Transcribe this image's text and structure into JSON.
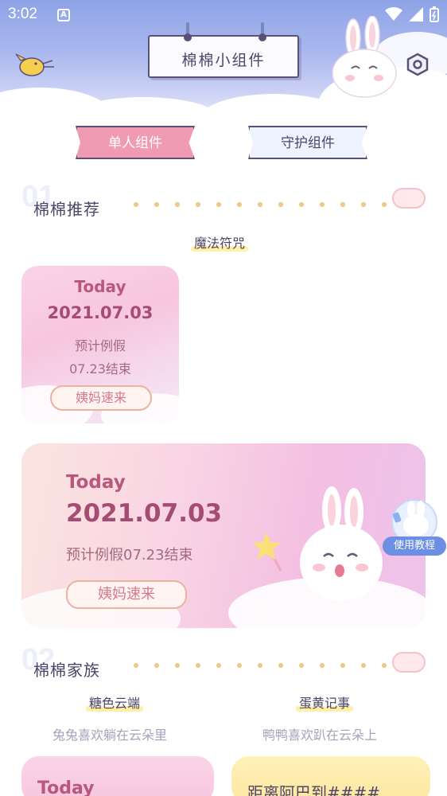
{
  "status_bar": {
    "time": "3:02",
    "keyboard_badge": "A"
  },
  "header": {
    "title": "棉棉小组件"
  },
  "tabs": [
    {
      "label": "单人组件",
      "active": true
    },
    {
      "label": "守护组件",
      "active": false
    }
  ],
  "section_recommend": {
    "number": "01",
    "title": "棉棉推荐",
    "subtitle": "魔法符咒",
    "small_card": {
      "today": "Today",
      "date": "2021.07.03",
      "line1": "预计例假",
      "line2": "07.23结束",
      "ribbon": "姨妈速来"
    },
    "big_card": {
      "today": "Today",
      "date": "2021.07.03",
      "line1": "预计例假07.23结束",
      "ribbon": "姨妈速来"
    }
  },
  "help_button": {
    "label": "使用教程"
  },
  "section_family": {
    "number": "02",
    "title": "棉棉家族",
    "items": [
      {
        "name": "糖色云端",
        "desc": "兔兔喜欢躺在云朵里",
        "card_title": "Today"
      },
      {
        "name": "蛋黄记事",
        "desc": "鸭鸭喜欢趴在云朵上",
        "card_title": "距离阿巴到####"
      }
    ]
  },
  "colors": {
    "accent_pink": "#f19ab4",
    "header_sky": "#8ea3e6",
    "help_blue": "#6d8fe3",
    "text_dark": "#4e4468"
  }
}
